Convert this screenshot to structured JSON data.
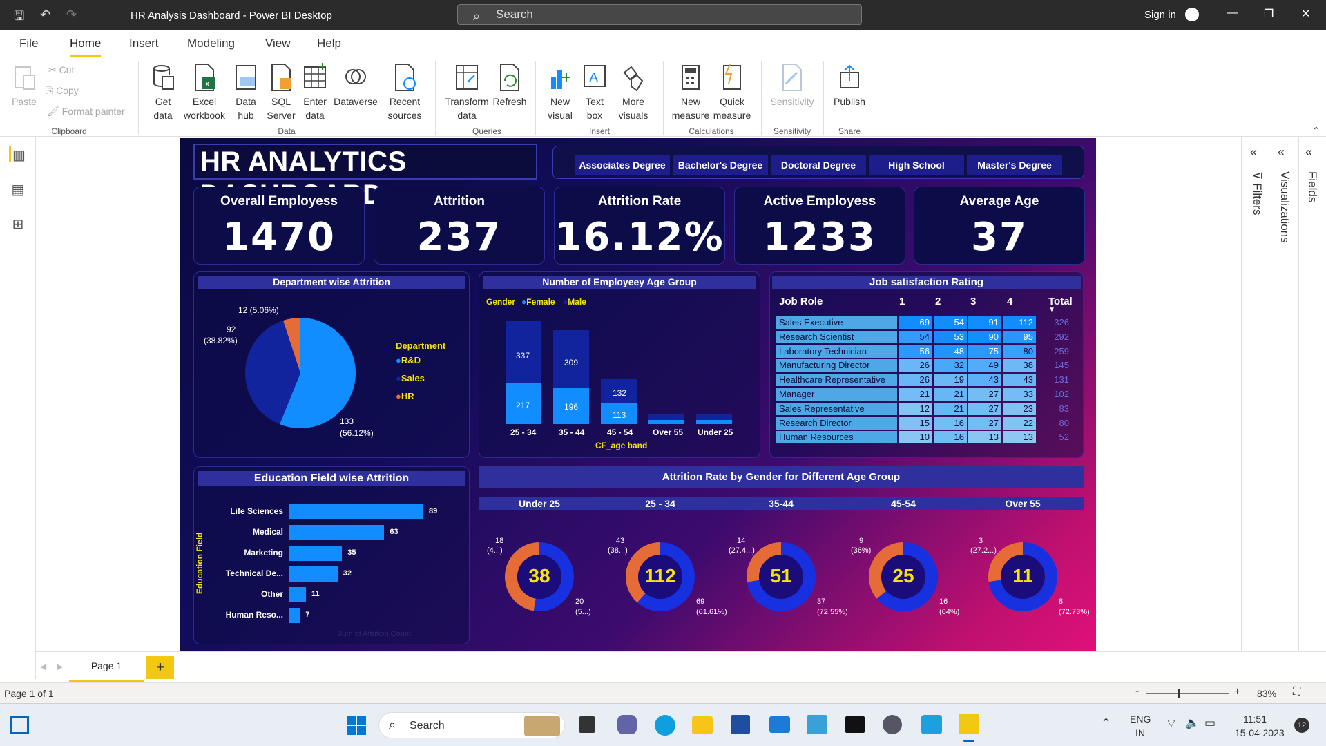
{
  "window": {
    "title": "HR Analysis Dashboard - Power BI Desktop",
    "search_placeholder": "Search",
    "sign_in": "Sign in"
  },
  "menu": [
    "File",
    "Home",
    "Insert",
    "Modeling",
    "View",
    "Help"
  ],
  "ribbon": {
    "clipboard": {
      "paste": "Paste",
      "cut": "Cut",
      "copy": "Copy",
      "format_painter": "Format painter",
      "group": "Clipboard"
    },
    "data": {
      "get_data": "Get data",
      "excel": "Excel workbook",
      "data_hub": "Data hub",
      "sql": "SQL Server",
      "enter": "Enter data",
      "dataverse": "Dataverse",
      "recent": "Recent sources",
      "group": "Data"
    },
    "queries": {
      "transform": "Transform data",
      "refresh": "Refresh",
      "group": "Queries"
    },
    "insert": {
      "new_visual": "New visual",
      "text_box": "Text box",
      "more_visuals": "More visuals",
      "group": "Insert"
    },
    "calculations": {
      "new_measure": "New measure",
      "quick_measure": "Quick measure",
      "group": "Calculations"
    },
    "sensitivity": {
      "label": "Sensitivity",
      "group": "Sensitivity"
    },
    "share": {
      "publish": "Publish",
      "group": "Share"
    }
  },
  "dashboard": {
    "title": "HR ANALYTICS DASHBOARD",
    "slicers": [
      "Associates Degree",
      "Bachelor's Degree",
      "Doctoral Degree",
      "High School",
      "Master's Degree"
    ],
    "kpis": [
      {
        "label": "Overall Employess",
        "value": "1470"
      },
      {
        "label": "Attrition",
        "value": "237"
      },
      {
        "label": "Attrition Rate",
        "value": "16.12%"
      },
      {
        "label": "Active Employess",
        "value": "1233"
      },
      {
        "label": "Average Age",
        "value": "37"
      }
    ],
    "dept": {
      "title": "Department wise Attrition",
      "legend_title": "Department",
      "labels": {
        "hr": "12 (5.06%)",
        "sales_v": "92",
        "sales_p": "(38.82%)",
        "rd_v": "133",
        "rd_p": "(56.12%)"
      },
      "legend": [
        "R&D",
        "Sales",
        "HR"
      ]
    },
    "age": {
      "title": "Number of Employeey Age Group",
      "legend_title": "Gender",
      "legend": [
        "Female",
        "Male"
      ],
      "xlabel": "CF_age band",
      "labels": {
        "b1_top": "337",
        "b1_bot": "217",
        "b1_x": "25 - 34",
        "b2_top": "309",
        "b2_bot": "196",
        "b2_x": "35 - 44",
        "b3_top": "132",
        "b3_bot": "113",
        "b3_x": "45 - 54",
        "b4_x": "Over 55",
        "b5_x": "Under 25"
      }
    },
    "job": {
      "title": "Job satisfaction Rating",
      "headers": [
        "Job Role",
        "1",
        "2",
        "3",
        "4",
        "Total"
      ],
      "rows": [
        {
          "role": "Sales Executive",
          "c1": "69",
          "c2": "54",
          "c3": "91",
          "c4": "112",
          "total": "326"
        },
        {
          "role": "Research Scientist",
          "c1": "54",
          "c2": "53",
          "c3": "90",
          "c4": "95",
          "total": "292"
        },
        {
          "role": "Laboratory Technician",
          "c1": "56",
          "c2": "48",
          "c3": "75",
          "c4": "80",
          "total": "259"
        },
        {
          "role": "Manufacturing Director",
          "c1": "26",
          "c2": "32",
          "c3": "49",
          "c4": "38",
          "total": "145"
        },
        {
          "role": "Healthcare Representative",
          "c1": "26",
          "c2": "19",
          "c3": "43",
          "c4": "43",
          "total": "131"
        },
        {
          "role": "Manager",
          "c1": "21",
          "c2": "21",
          "c3": "27",
          "c4": "33",
          "total": "102"
        },
        {
          "role": "Sales Representative",
          "c1": "12",
          "c2": "21",
          "c3": "27",
          "c4": "23",
          "total": "83"
        },
        {
          "role": "Research Director",
          "c1": "15",
          "c2": "16",
          "c3": "27",
          "c4": "22",
          "total": "80"
        },
        {
          "role": "Human Resources",
          "c1": "10",
          "c2": "16",
          "c3": "13",
          "c4": "13",
          "total": "52"
        }
      ]
    },
    "edu": {
      "title": "Education Field wise Attrition",
      "ylabel": "Education Field",
      "xlabel": "Sum of Attrition Count",
      "rows": [
        {
          "label": "Life Sciences",
          "value": "89"
        },
        {
          "label": "Medical",
          "value": "63"
        },
        {
          "label": "Marketing",
          "value": "35"
        },
        {
          "label": "Technical De...",
          "value": "32"
        },
        {
          "label": "Other",
          "value": "11"
        },
        {
          "label": "Human Reso...",
          "value": "7"
        }
      ]
    },
    "gender": {
      "title": "Attrition Rate by Gender for Different Age Group",
      "groups": [
        {
          "name": "Under 25",
          "center": "38",
          "a": "18",
          "a2": "(4...)",
          "b": "20",
          "b2": "(5...)"
        },
        {
          "name": "25 - 34",
          "center": "112",
          "a": "43",
          "a2": "(38...)",
          "b": "69",
          "b2": "(61.61%)"
        },
        {
          "name": "35-44",
          "center": "51",
          "a": "14",
          "a2": "(27.4...)",
          "b": "37",
          "b2": "(72.55%)"
        },
        {
          "name": "45-54",
          "center": "25",
          "a": "9",
          "a2": "(36%)",
          "b": "16",
          "b2": "(64%)"
        },
        {
          "name": "Over 55",
          "center": "11",
          "a": "3",
          "a2": "(27.2...)",
          "b": "8",
          "b2": "(72.73%)"
        }
      ]
    }
  },
  "right_panes": [
    "Filters",
    "Visualizations",
    "Fields"
  ],
  "page_tab": "Page 1",
  "status": {
    "page": "Page 1 of 1",
    "zoom": "83%"
  },
  "taskbar": {
    "search": "Search",
    "lang1": "ENG",
    "lang2": "IN",
    "time": "11:51",
    "date": "15-04-2023",
    "badge": "12"
  },
  "colors": {
    "female": "#118dff",
    "male": "#12239e",
    "hr": "#e66c37",
    "accent": "#f2c811"
  },
  "chart_data": [
    {
      "type": "pie",
      "title": "Department wise Attrition",
      "categories": [
        "R&D",
        "Sales",
        "HR"
      ],
      "values": [
        133,
        92,
        12
      ]
    },
    {
      "type": "bar",
      "title": "Number of Employeey Age Group",
      "categories": [
        "25 - 34",
        "35 - 44",
        "45 - 54",
        "Over 55",
        "Under 25"
      ],
      "series": [
        {
          "name": "Female",
          "values": [
            217,
            196,
            113,
            0,
            0
          ]
        },
        {
          "name": "Male",
          "values": [
            337,
            309,
            132,
            0,
            0
          ]
        }
      ],
      "xlabel": "CF_age band"
    },
    {
      "type": "bar",
      "title": "Education Field wise Attrition",
      "categories": [
        "Life Sciences",
        "Medical",
        "Marketing",
        "Technical De...",
        "Other",
        "Human Reso..."
      ],
      "values": [
        89,
        63,
        35,
        32,
        11,
        7
      ],
      "xlabel": "Sum of Attrition Count",
      "ylabel": "Education Field"
    },
    {
      "type": "pie",
      "title": "Attrition Rate by Gender for Different Age Group",
      "categories": [
        "Under 25",
        "25 - 34",
        "35-44",
        "45-54",
        "Over 55"
      ],
      "series": [
        {
          "values": [
            18,
            43,
            14,
            9,
            3
          ]
        },
        {
          "values": [
            20,
            69,
            37,
            16,
            8
          ]
        }
      ]
    }
  ]
}
